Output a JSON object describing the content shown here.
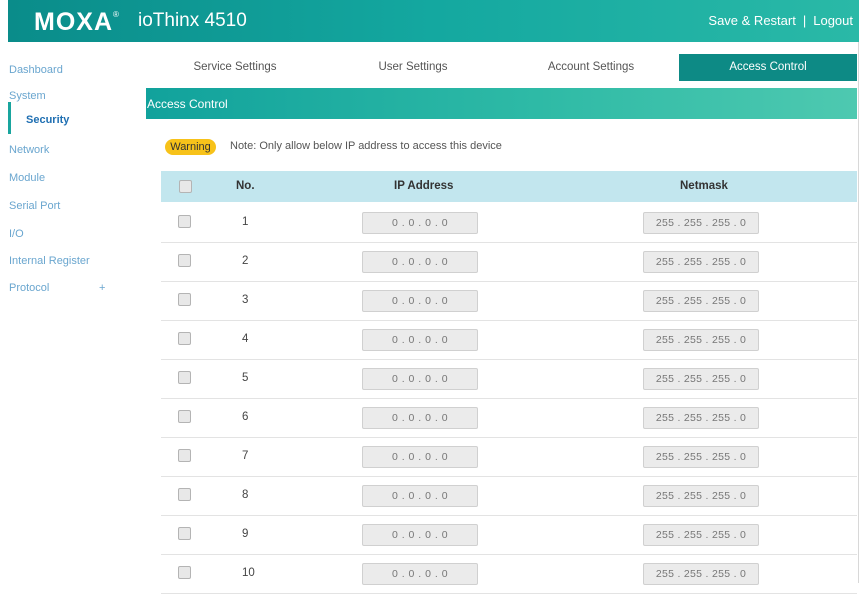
{
  "header": {
    "brand": "MOXA",
    "product": "ioThinx 4510",
    "save_restart": "Save & Restart",
    "separator": "|",
    "logout": "Logout",
    "bar_color": "#0d8a85"
  },
  "sidebar": {
    "items": [
      {
        "label": "Dashboard"
      },
      {
        "label": "System"
      },
      {
        "label": "Security",
        "active": true
      },
      {
        "label": "Network"
      },
      {
        "label": "Module"
      },
      {
        "label": "Serial Port"
      },
      {
        "label": "I/O"
      },
      {
        "label": "Internal Register"
      },
      {
        "label": "Protocol",
        "expand": "+"
      }
    ]
  },
  "tabs": [
    {
      "label": "Service Settings"
    },
    {
      "label": "User Settings"
    },
    {
      "label": "Account Settings"
    },
    {
      "label": "Access Control",
      "active": true
    }
  ],
  "panel": {
    "title": "Access Control",
    "warning_badge": "Warning",
    "warning_note": "Note: Only allow below IP address to access this device",
    "badge_color": "#f7c21a"
  },
  "table": {
    "columns": {
      "no": "No.",
      "ip": "IP Address",
      "mask": "Netmask"
    },
    "rows": [
      {
        "no": "1",
        "ip": "0 . 0 . 0 . 0",
        "mask": "255 . 255 . 255 . 0"
      },
      {
        "no": "2",
        "ip": "0 . 0 . 0 . 0",
        "mask": "255 . 255 . 255 . 0"
      },
      {
        "no": "3",
        "ip": "0 . 0 . 0 . 0",
        "mask": "255 . 255 . 255 . 0"
      },
      {
        "no": "4",
        "ip": "0 . 0 . 0 . 0",
        "mask": "255 . 255 . 255 . 0"
      },
      {
        "no": "5",
        "ip": "0 . 0 . 0 . 0",
        "mask": "255 . 255 . 255 . 0"
      },
      {
        "no": "6",
        "ip": "0 . 0 . 0 . 0",
        "mask": "255 . 255 . 255 . 0"
      },
      {
        "no": "7",
        "ip": "0 . 0 . 0 . 0",
        "mask": "255 . 255 . 255 . 0"
      },
      {
        "no": "8",
        "ip": "0 . 0 . 0 . 0",
        "mask": "255 . 255 . 255 . 0"
      },
      {
        "no": "9",
        "ip": "0 . 0 . 0 . 0",
        "mask": "255 . 255 . 255 . 0"
      },
      {
        "no": "10",
        "ip": "0 . 0 . 0 . 0",
        "mask": "255 . 255 . 255 . 0"
      }
    ]
  }
}
